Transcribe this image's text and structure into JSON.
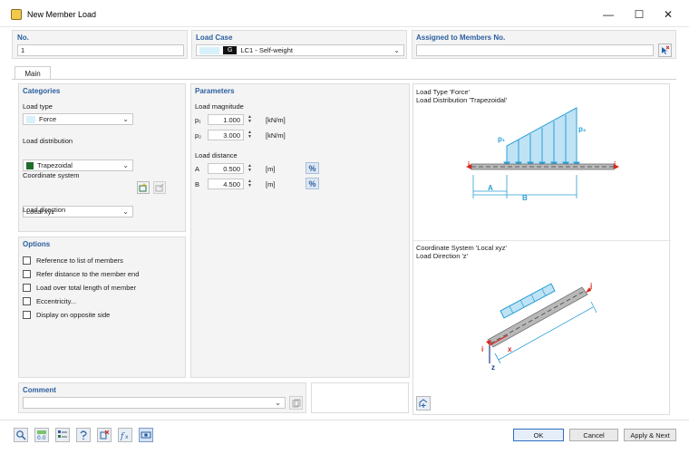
{
  "window": {
    "title": "New Member Load",
    "minimize": "—",
    "maximize": "☐",
    "close": "✕"
  },
  "header": {
    "no_label": "No.",
    "no_value": "1",
    "load_case_label": "Load Case",
    "load_case_tag": "G",
    "load_case_value": "LC1 - Self-weight",
    "assigned_label": "Assigned to Members No.",
    "assigned_value": ""
  },
  "tabs": [
    {
      "label": "Main"
    }
  ],
  "categories": {
    "title": "Categories",
    "load_type_label": "Load type",
    "load_type_value": "Force",
    "load_distribution_label": "Load distribution",
    "load_distribution_value": "Trapezoidal",
    "coordinate_system_label": "Coordinate system",
    "coordinate_system_value": "Local xyz",
    "load_direction_label": "Load direction",
    "load_direction_value": "z"
  },
  "parameters": {
    "title": "Parameters",
    "load_magnitude_label": "Load magnitude",
    "p1_label": "p₁",
    "p1_value": "1.000",
    "p1_unit": "[kN/m]",
    "p2_label": "p₂",
    "p2_value": "3.000",
    "p2_unit": "[kN/m]",
    "load_distance_label": "Load distance",
    "a_label": "A",
    "a_value": "0.500",
    "a_unit": "[m]",
    "b_label": "B",
    "b_value": "4.500",
    "b_unit": "[m]",
    "pct_symbol": "%"
  },
  "options": {
    "title": "Options",
    "items": [
      {
        "label": "Reference to list of members"
      },
      {
        "label": "Refer distance to the member end"
      },
      {
        "label": "Load over total length of member"
      },
      {
        "label": "Eccentricity..."
      },
      {
        "label": "Display on opposite side"
      }
    ]
  },
  "preview": {
    "load_caption_line1": "Load Type 'Force'",
    "load_caption_line2": "Load Distribution 'Trapezoidal'",
    "coord_caption_line1": "Coordinate System 'Local xyz'",
    "coord_caption_line2": "Load Direction 'z'",
    "p1": "p₁",
    "p2": "p₂",
    "a": "A",
    "b": "B",
    "i": "i",
    "j": "j",
    "x": "x",
    "z": "z"
  },
  "comment": {
    "title": "Comment",
    "value": ""
  },
  "footer": {
    "ok": "OK",
    "cancel": "Cancel",
    "apply_next": "Apply & Next"
  },
  "colors": {
    "accent": "#2b5f9e",
    "load_fill": "#bfe3f5",
    "load_stroke": "#2a9fd6",
    "member_red": "#d9261c"
  }
}
